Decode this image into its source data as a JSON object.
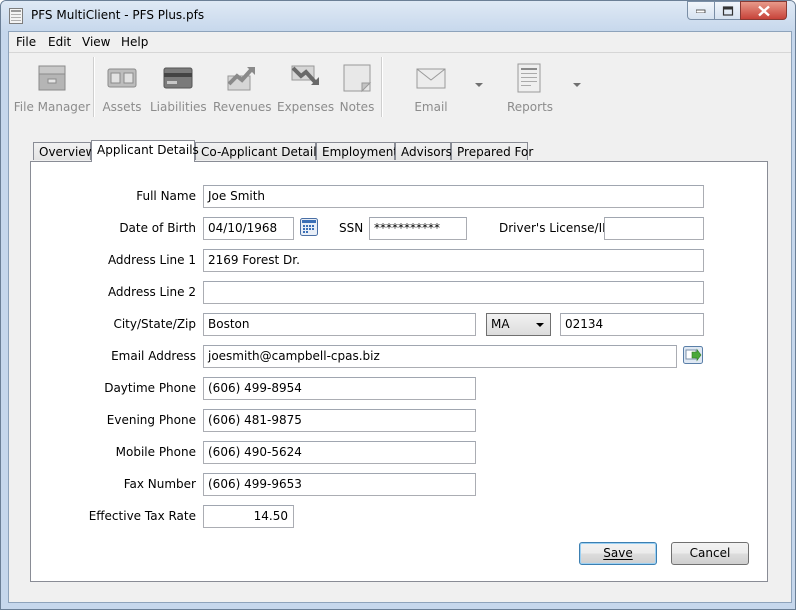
{
  "window": {
    "title": "PFS MultiClient - PFS Plus.pfs"
  },
  "menu": [
    "File",
    "Edit",
    "View",
    "Help"
  ],
  "toolbar": {
    "items": [
      {
        "label": "File Manager",
        "icon": "file-manager-icon"
      },
      {
        "label": "Assets",
        "icon": "assets-icon"
      },
      {
        "label": "Liabilities",
        "icon": "liabilities-icon"
      },
      {
        "label": "Revenues",
        "icon": "revenues-icon"
      },
      {
        "label": "Expenses",
        "icon": "expenses-icon"
      },
      {
        "label": "Notes",
        "icon": "notes-icon"
      },
      {
        "label": "Email",
        "icon": "email-icon"
      },
      {
        "label": "Reports",
        "icon": "reports-icon"
      }
    ]
  },
  "tabs": [
    "Overview",
    "Applicant Details",
    "Co-Applicant Details",
    "Employment",
    "Advisors",
    "Prepared For"
  ],
  "active_tab": "Applicant Details",
  "form": {
    "full_name": {
      "label": "Full Name",
      "value": "Joe Smith"
    },
    "dob": {
      "label": "Date of Birth",
      "value": "04/10/1968"
    },
    "ssn": {
      "label": "SSN",
      "value": "***********"
    },
    "license": {
      "label": "Driver's License/ID",
      "value": ""
    },
    "address1": {
      "label": "Address Line 1",
      "value": "2169 Forest Dr."
    },
    "address2": {
      "label": "Address Line 2",
      "value": ""
    },
    "city_state_zip": {
      "label": "City/State/Zip",
      "city": "Boston",
      "state": "MA",
      "zip": "02134"
    },
    "email": {
      "label": "Email Address",
      "value": "joesmith@campbell-cpas.biz"
    },
    "daytime_phone": {
      "label": "Daytime Phone",
      "value": "(606) 499-8954"
    },
    "evening_phone": {
      "label": "Evening Phone",
      "value": "(606) 481-9875"
    },
    "mobile_phone": {
      "label": "Mobile Phone",
      "value": "(606) 490-5624"
    },
    "fax": {
      "label": "Fax Number",
      "value": "(606) 499-9653"
    },
    "tax_rate": {
      "label": "Effective Tax Rate",
      "value": "14.50"
    }
  },
  "buttons": {
    "save": "Save",
    "cancel": "Cancel"
  },
  "colors": {
    "titlebar": "#c7d8ec",
    "close_button": "#c7433a",
    "default_button_border": "#3c7fb1"
  }
}
